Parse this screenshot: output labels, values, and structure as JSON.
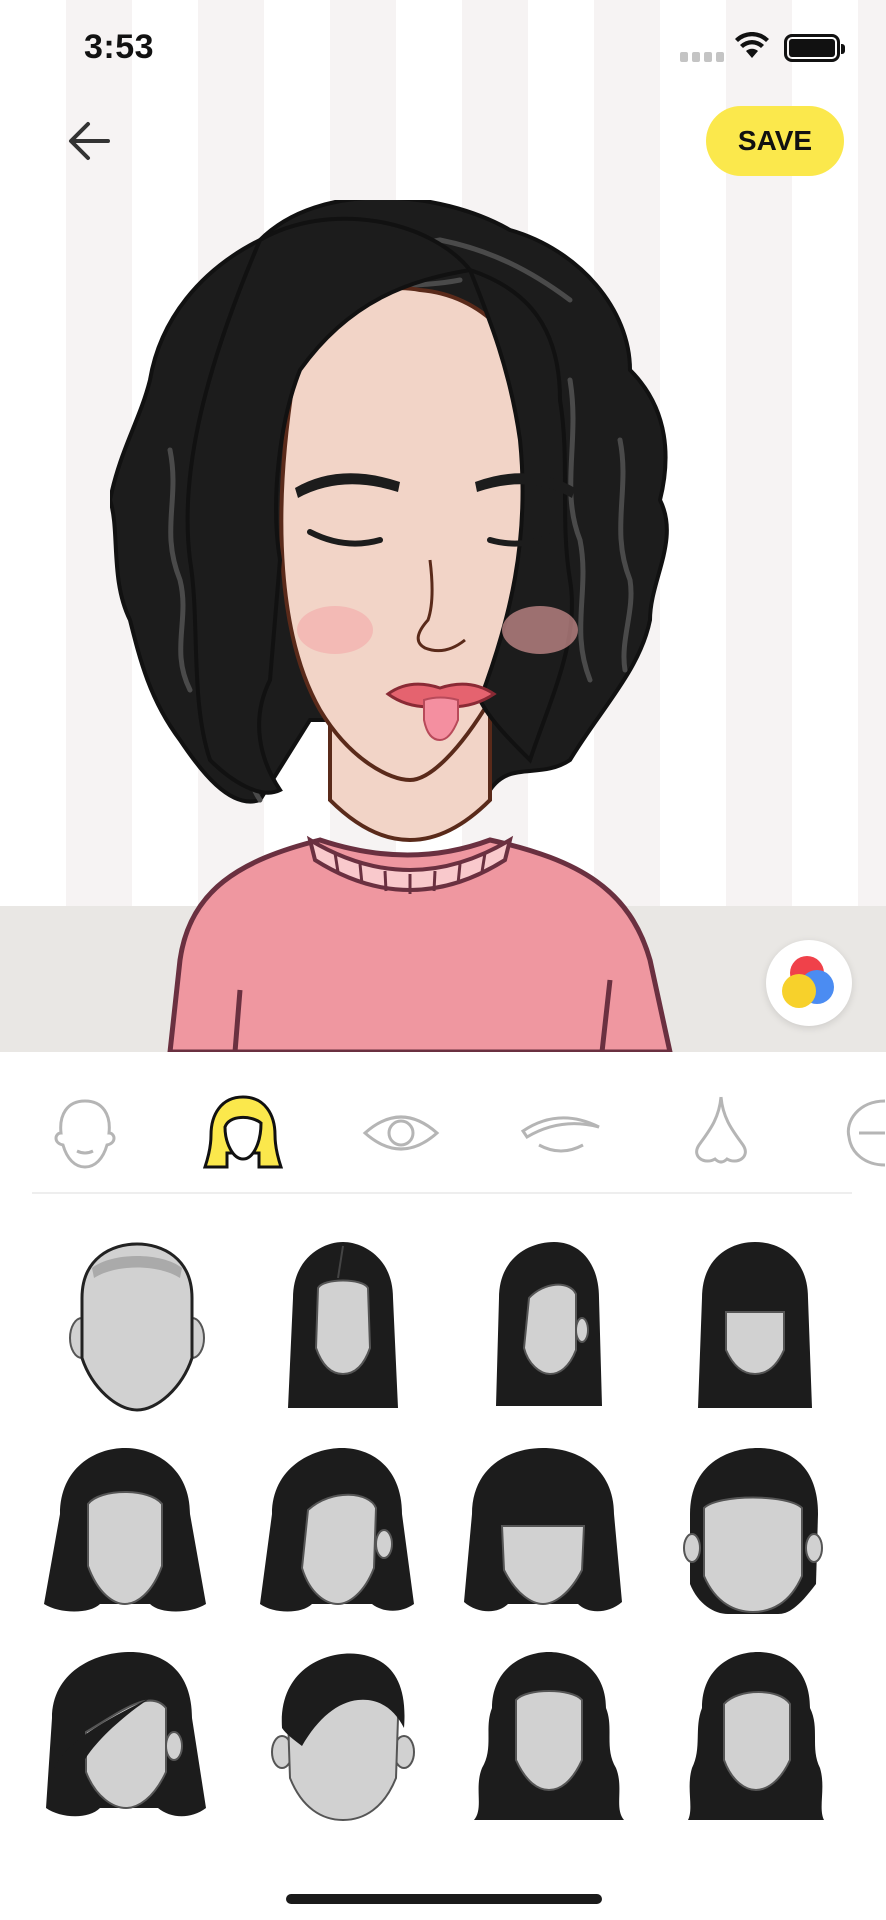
{
  "status_bar": {
    "time": "3:53"
  },
  "toolbar": {
    "save_label": "SAVE"
  },
  "categories": [
    {
      "name": "face",
      "icon": "face-icon",
      "selected": false
    },
    {
      "name": "hair",
      "icon": "hair-icon",
      "selected": true
    },
    {
      "name": "eyes",
      "icon": "eye-icon",
      "selected": false
    },
    {
      "name": "eyebrows",
      "icon": "eyebrow-icon",
      "selected": false
    },
    {
      "name": "nose",
      "icon": "nose-icon",
      "selected": false
    },
    {
      "name": "ears",
      "icon": "ear-icon",
      "selected": false
    }
  ],
  "hair_styles": [
    "bald",
    "long-straight-center-part",
    "long-straight-side-part",
    "long-straight-bangs",
    "bob-center-part",
    "bob-side-part",
    "bob-bangs",
    "short-slick",
    "asymmetric-bob",
    "short-pixie",
    "wavy-long",
    "wavy-shoulder"
  ],
  "colors": {
    "accent": "#fbe84c",
    "hair": "#1c1c1c",
    "skin": "#f2d4c7",
    "sweater": "#ef97a0",
    "face_placeholder": "#d1d1d1",
    "category_icon": "#b5b5b5"
  }
}
